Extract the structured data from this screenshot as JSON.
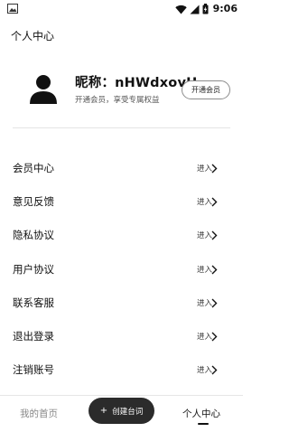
{
  "status_bar": {
    "time": "9:06",
    "icons": [
      "image-icon",
      "wifi-icon",
      "signal-icon",
      "battery-charging-icon"
    ]
  },
  "header": {
    "title": "个人中心"
  },
  "profile": {
    "nickname": "昵称：nHWdxovH",
    "subtitle": "开通会员，享受专属权益",
    "open_membership_label": "开通会员",
    "avatar_icon": "user-avatar-icon"
  },
  "menu": {
    "enter_label": "进入",
    "items": [
      {
        "label": "会员中心"
      },
      {
        "label": "意见反馈"
      },
      {
        "label": "隐私协议"
      },
      {
        "label": "用户协议"
      },
      {
        "label": "联系客服"
      },
      {
        "label": "退出登录"
      },
      {
        "label": "注销账号"
      }
    ]
  },
  "tab_bar": {
    "home_label": "我的首页",
    "create_label": "创建台词",
    "create_icon": "plus-icon",
    "profile_label": "个人中心",
    "active_tab": "个人中心"
  },
  "colors": {
    "background": "#ffffff",
    "text_primary": "#111111",
    "text_secondary": "#888888",
    "create_button": "#2b2b2b"
  }
}
